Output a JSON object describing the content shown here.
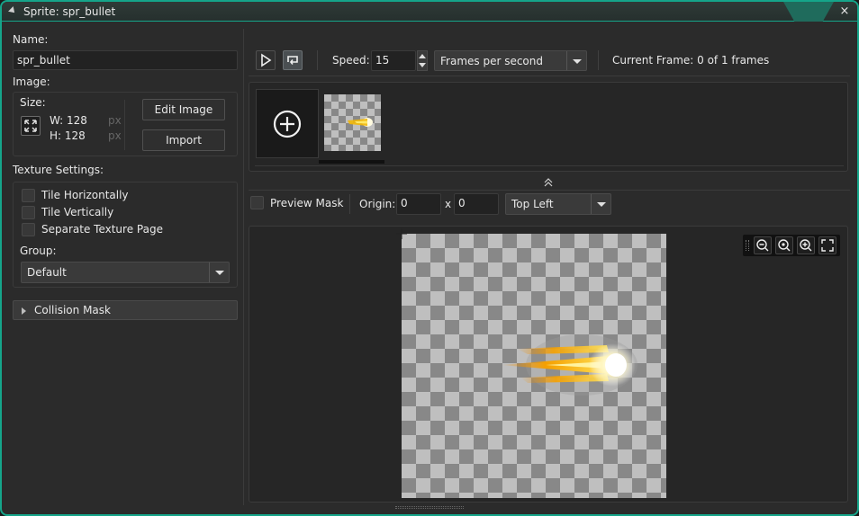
{
  "window": {
    "title": "Sprite: spr_bullet",
    "close": "×"
  },
  "left": {
    "name_label": "Name:",
    "name_value": "spr_bullet",
    "image_label": "Image:",
    "size_label": "Size:",
    "width": "W: 128",
    "height": "H: 128",
    "px": "px",
    "edit_image": "Edit Image",
    "import": "Import",
    "texture_label": "Texture Settings:",
    "tile_h": "Tile Horizontally",
    "tile_v": "Tile Vertically",
    "separate_page": "Separate Texture Page",
    "group_label": "Group:",
    "group_value": "Default",
    "collision_mask": "Collision Mask"
  },
  "toolbar": {
    "speed_label": "Speed:",
    "speed_value": "15",
    "speed_unit": "Frames per second",
    "current_frame": "Current Frame: 0 of 1 frames"
  },
  "mask_bar": {
    "preview_mask": "Preview Mask",
    "origin_label": "Origin:",
    "origin_x": "0",
    "x_sep": "x",
    "origin_y": "0",
    "origin_preset": "Top Left"
  },
  "icons": [
    "play-icon",
    "loop-icon",
    "add-frame-icon",
    "collapse-icon",
    "zoom-out-icon",
    "zoom-reset-icon",
    "zoom-in-icon",
    "fit-icon"
  ],
  "colors": {
    "accent": "#15a58a",
    "bg": "#2b2b2b"
  }
}
